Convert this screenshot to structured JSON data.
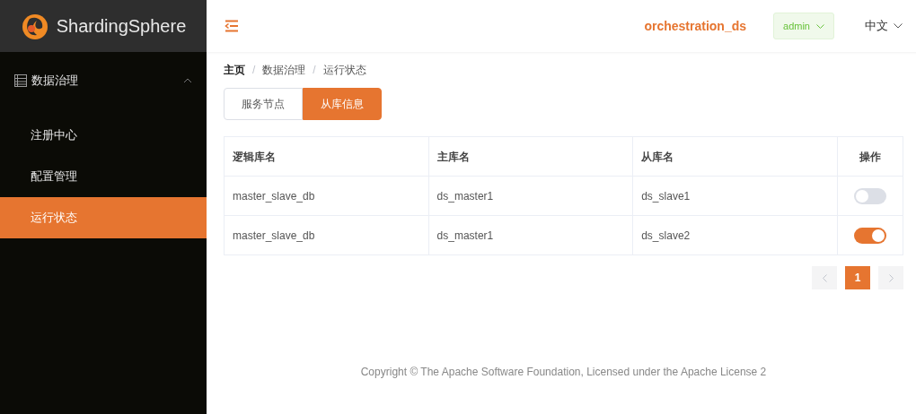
{
  "logo": {
    "text": "ShardingSphere"
  },
  "sidebar": {
    "group": {
      "label": "数据治理",
      "expanded": true
    },
    "items": [
      {
        "label": "注册中心",
        "selected": false
      },
      {
        "label": "配置管理",
        "selected": false
      },
      {
        "label": "运行状态",
        "selected": true
      }
    ]
  },
  "header": {
    "schema": "orchestration_ds",
    "user": "admin",
    "language": "中文"
  },
  "breadcrumb": [
    {
      "label": "主页",
      "bold": true
    },
    {
      "separator": "/",
      "label": "数据治理",
      "bold": false
    },
    {
      "separator": "/",
      "label": "运行状态",
      "bold": false
    }
  ],
  "tabs": [
    {
      "label": "服务节点",
      "selected": false
    },
    {
      "label": "从库信息",
      "selected": true
    }
  ],
  "table": {
    "columns": [
      "逻辑库名",
      "主库名",
      "从库名",
      "操作"
    ],
    "rows": [
      {
        "logic": "master_slave_db",
        "master": "ds_master1",
        "slave": "ds_slave1",
        "on": false
      },
      {
        "logic": "master_slave_db",
        "master": "ds_master1",
        "slave": "ds_slave2",
        "on": true
      }
    ]
  },
  "pagination": {
    "pages": [
      {
        "label": "1",
        "selected": true
      }
    ],
    "prev_disabled": true,
    "next_disabled": true
  },
  "footer": "Copyright © The Apache Software Foundation, Licensed under the Apache License 2"
}
